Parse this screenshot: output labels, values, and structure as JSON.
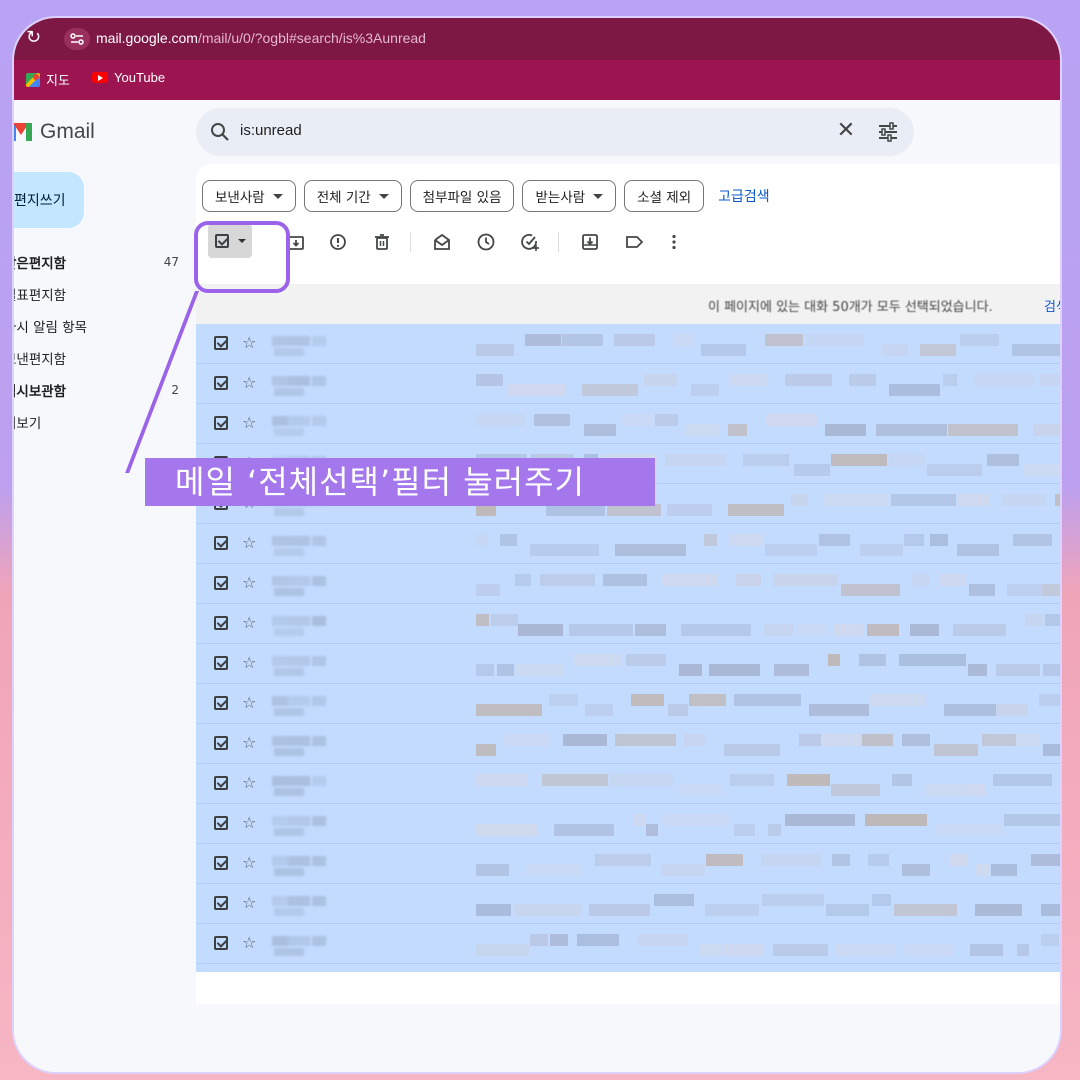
{
  "browser": {
    "url_host": "mail.google.com",
    "url_path": "/mail/u/0/?ogbl#search/is%3Aunread",
    "bookmarks": [
      {
        "label": "지도",
        "icon": "maps-icon"
      },
      {
        "label": "YouTube",
        "icon": "youtube-icon"
      }
    ]
  },
  "gmail": {
    "logo_text": "Gmail",
    "compose_label": "편지쓰기",
    "nav": [
      {
        "label": "받은편지함",
        "count": "47",
        "bold": true
      },
      {
        "label": "별표편지함",
        "count": "",
        "bold": false
      },
      {
        "label": "다시 알림 항목",
        "count": "",
        "bold": false
      },
      {
        "label": "보낸편지함",
        "count": "",
        "bold": false
      },
      {
        "label": "임시보관함",
        "count": "2",
        "bold": true
      },
      {
        "label": "더보기",
        "count": "",
        "bold": false
      }
    ],
    "search": {
      "query": "is:unread"
    },
    "chips": [
      {
        "label": "보낸사람",
        "dropdown": true
      },
      {
        "label": "전체 기간",
        "dropdown": true
      },
      {
        "label": "첨부파일 있음",
        "dropdown": false
      },
      {
        "label": "받는사람",
        "dropdown": true
      },
      {
        "label": "소셜 제외",
        "dropdown": false
      }
    ],
    "advanced_search": "고급검색",
    "toolbar_icons": [
      "archive-icon",
      "report-spam-icon",
      "delete-icon",
      "mark-read-icon",
      "snooze-icon",
      "add-task-icon",
      "move-to-icon",
      "label-icon",
      "more-icon"
    ],
    "banner": {
      "text": "이 페이지에 있는 대화 50개가 모두 선택되었습니다.",
      "link": "검색"
    },
    "row_count": 17
  },
  "annotation": {
    "callout_text": "메일 ‘전체선택’필터 눌러주기",
    "accent": "#9b63ea"
  }
}
